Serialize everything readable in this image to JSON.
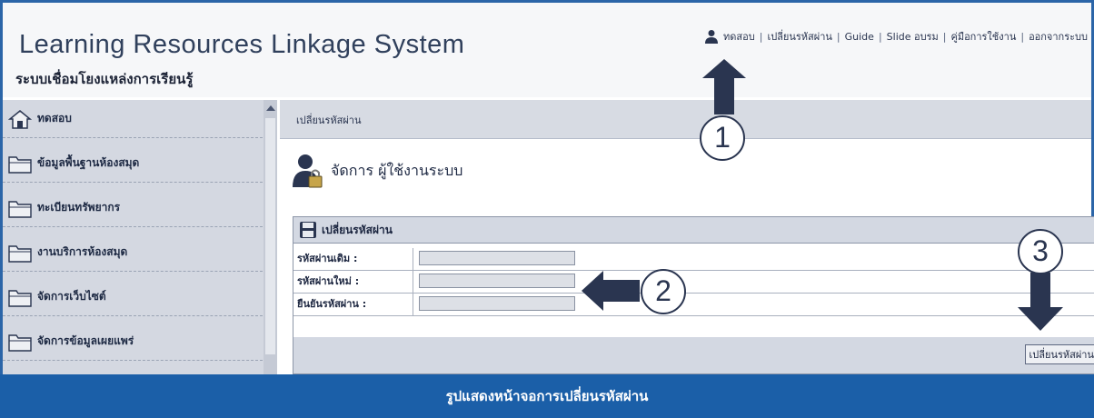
{
  "header": {
    "title_en": "Learning Resources Linkage System",
    "title_th": "ระบบเชื่อมโยงแหล่งการเรียนรู้"
  },
  "topnav": {
    "user": "ทดสอบ",
    "items": [
      "เปลี่ยนรหัสผ่าน",
      "Guide",
      "Slide อบรม",
      "คู่มือการใช้งาน",
      "ออกจากระบบ"
    ]
  },
  "sidebar": {
    "items": [
      {
        "label": "ทดสอบ",
        "icon": "home-icon"
      },
      {
        "label": "ข้อมูลพื้นฐานห้องสมุด",
        "icon": "folder-icon"
      },
      {
        "label": "ทะเบียนทรัพยากร",
        "icon": "folder-icon"
      },
      {
        "label": "งานบริการห้องสมุด",
        "icon": "folder-icon"
      },
      {
        "label": "จัดการเว็บไซต์",
        "icon": "folder-icon"
      },
      {
        "label": "จัดการข้อมูลเผยแพร่",
        "icon": "folder-icon"
      }
    ]
  },
  "main": {
    "breadcrumb": "เปลี่ยนรหัสผ่าน",
    "page_title": "จัดการ ผู้ใช้งานระบบ",
    "form": {
      "title": "เปลี่ยนรหัสผ่าน",
      "fields": [
        {
          "label": "รหัสผ่านเดิม :",
          "value": ""
        },
        {
          "label": "รหัสผ่านใหม่ :",
          "value": ""
        },
        {
          "label": "ยืนยันรหัสผ่าน :",
          "value": ""
        }
      ],
      "submit_label": "เปลี่ยนรหัสผ่าน"
    }
  },
  "annotations": {
    "step1": "1",
    "step2": "2",
    "step3": "3"
  },
  "caption": "รูปแสดงหน้าจอการเปลี่ยนรหัสผ่าน",
  "colors": {
    "frame": "#2b65a8",
    "caption_bg": "#1b5fa8",
    "arrow": "#2a3550"
  }
}
